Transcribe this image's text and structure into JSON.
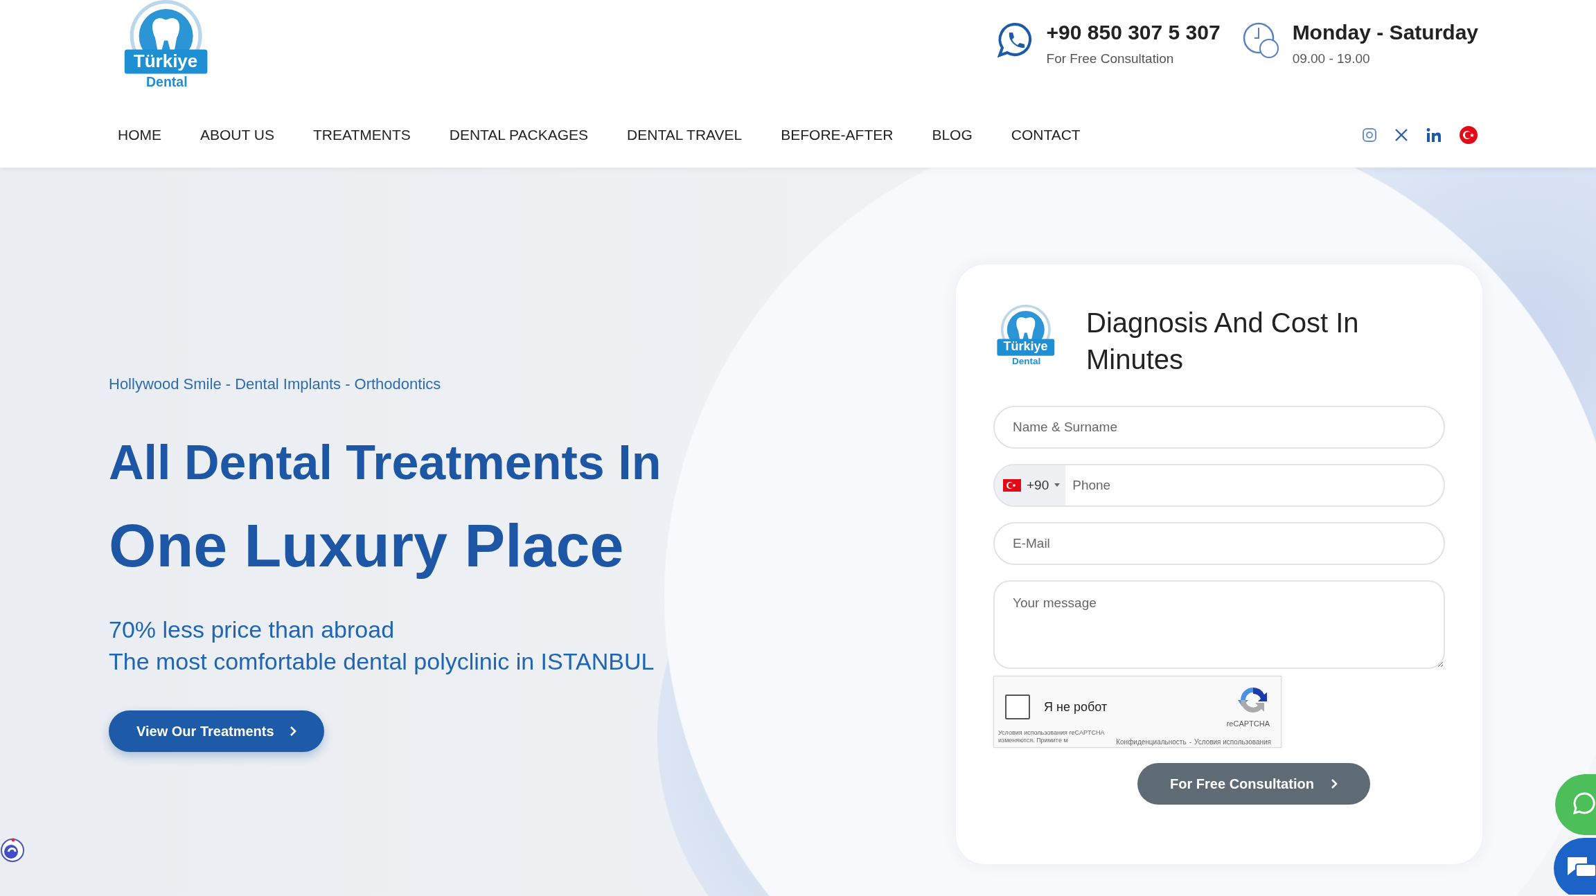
{
  "header": {
    "logo_text": [
      "Türkiye",
      "Dental"
    ],
    "phone": {
      "number": "+90 850 307 5 307",
      "note": "For Free Consultation"
    },
    "hours": {
      "days": "Monday - Saturday",
      "time": "09.00 - 19.00"
    },
    "nav": [
      "HOME",
      "ABOUT US",
      "TREATMENTS",
      "DENTAL PACKAGES",
      "DENTAL TRAVEL",
      "BEFORE-AFTER",
      "BLOG",
      "CONTACT"
    ]
  },
  "hero": {
    "tagline": "Hollywood Smile - Dental Implants - Orthodontics",
    "title_lines": [
      "All Dental Treatments In",
      "One Luxury Place"
    ],
    "subtitle_lines": [
      "70% less price than abroad",
      "The most comfortable dental polyclinic in ISTANBUL"
    ],
    "button": "View Our Treatments"
  },
  "form": {
    "logo_text": [
      "Türkiye",
      "Dental"
    ],
    "title": "Diagnosis And Cost In Minutes",
    "fields": [
      {
        "kind": "text",
        "placeholder": "Name & Surname"
      },
      {
        "kind": "phone",
        "code": "+90",
        "placeholder": "Phone"
      },
      {
        "kind": "text",
        "placeholder": "E-Mail"
      },
      {
        "kind": "textarea",
        "placeholder": "Your message"
      }
    ],
    "captcha": {
      "label": "Я не робот",
      "checked": false,
      "brand": "reCAPTCHA",
      "notice": "Условия использования reCAPTCHA изменяются. Примите м",
      "links": [
        "Конфиденциальность",
        "Условия использования"
      ],
      "link_separator": "-"
    },
    "submit": "For Free Consultation"
  }
}
